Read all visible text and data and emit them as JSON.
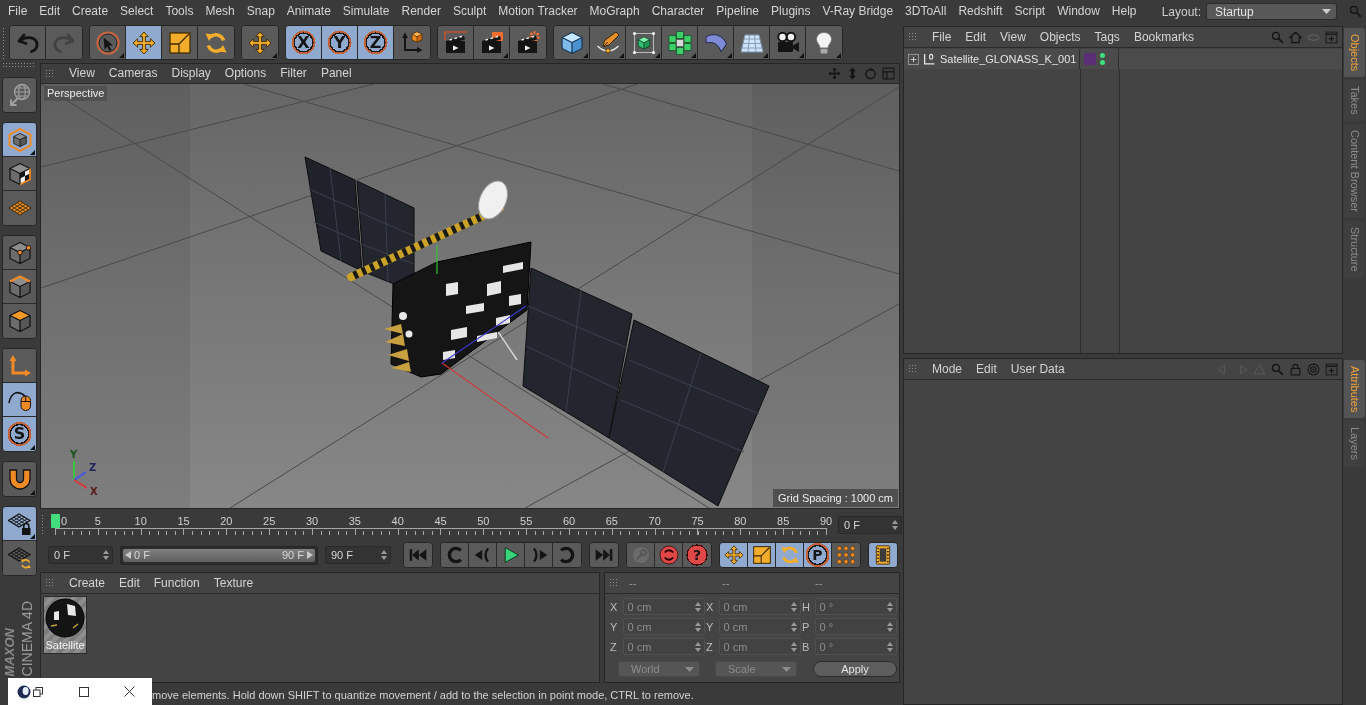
{
  "menu_bar": {
    "items": [
      "File",
      "Edit",
      "Create",
      "Select",
      "Tools",
      "Mesh",
      "Snap",
      "Animate",
      "Simulate",
      "Render",
      "Sculpt",
      "Motion Tracker",
      "MoGraph",
      "Character",
      "Pipeline",
      "Plugins",
      "V-Ray Bridge",
      "3DToAll",
      "Redshift",
      "Script",
      "Window",
      "Help"
    ],
    "layout_label": "Layout:",
    "layout_value": "Startup"
  },
  "toolbar": {
    "groups": [
      {
        "buttons": [
          {
            "kind": "undo",
            "active": false,
            "disabled": false,
            "submenu": false
          },
          {
            "kind": "redo",
            "active": false,
            "disabled": true,
            "submenu": false
          }
        ]
      },
      {
        "buttons": [
          {
            "kind": "live-select",
            "active": false,
            "disabled": false,
            "submenu": true
          },
          {
            "kind": "move",
            "active": true,
            "disabled": false,
            "submenu": false
          },
          {
            "kind": "scale",
            "active": false,
            "disabled": false,
            "submenu": false
          },
          {
            "kind": "rotate",
            "active": false,
            "disabled": false,
            "submenu": false
          }
        ]
      },
      {
        "buttons": [
          {
            "kind": "move",
            "active": false,
            "disabled": false,
            "submenu": true
          }
        ]
      },
      {
        "buttons": [
          {
            "kind": "axis-lock",
            "label": "X",
            "active": true,
            "disabled": false,
            "submenu": false
          },
          {
            "kind": "axis-lock",
            "label": "Y",
            "active": true,
            "disabled": false,
            "submenu": false
          },
          {
            "kind": "axis-lock",
            "label": "Z",
            "active": true,
            "disabled": false,
            "submenu": false
          },
          {
            "kind": "coordinate-system",
            "active": false,
            "disabled": false,
            "submenu": false
          }
        ]
      },
      {
        "buttons": [
          {
            "kind": "render-view",
            "active": false,
            "disabled": false,
            "submenu": false
          },
          {
            "kind": "render-picture-viewer",
            "active": false,
            "disabled": false,
            "submenu": true
          },
          {
            "kind": "render-settings",
            "active": false,
            "disabled": false,
            "submenu": false
          }
        ]
      },
      {
        "buttons": [
          {
            "kind": "cube",
            "active": false,
            "disabled": false,
            "submenu": true
          },
          {
            "kind": "pen",
            "active": false,
            "disabled": false,
            "submenu": true
          },
          {
            "kind": "subdivision",
            "active": false,
            "disabled": false,
            "submenu": true
          },
          {
            "kind": "cloner",
            "active": false,
            "disabled": false,
            "submenu": true
          },
          {
            "kind": "bend",
            "active": false,
            "disabled": false,
            "submenu": true
          },
          {
            "kind": "floor",
            "active": false,
            "disabled": false,
            "submenu": true
          },
          {
            "kind": "camera",
            "active": false,
            "disabled": false,
            "submenu": true
          },
          {
            "kind": "light",
            "active": false,
            "disabled": false,
            "submenu": true
          }
        ]
      }
    ]
  },
  "tool_palette": {
    "groups": [
      {
        "buttons": [
          {
            "kind": "make-editable",
            "active": false,
            "submenu": false
          }
        ]
      },
      {
        "buttons": [
          {
            "kind": "model",
            "active": true,
            "submenu": true
          },
          {
            "kind": "texture",
            "active": false,
            "submenu": false
          },
          {
            "kind": "workplane",
            "active": false,
            "submenu": false
          }
        ]
      },
      {
        "buttons": [
          {
            "kind": "points",
            "active": false,
            "submenu": false
          },
          {
            "kind": "edges",
            "active": false,
            "submenu": false
          },
          {
            "kind": "polygons",
            "active": false,
            "submenu": false
          }
        ]
      },
      {
        "buttons": [
          {
            "kind": "axis-mode",
            "active": false,
            "submenu": false
          },
          {
            "kind": "tweak",
            "active": true,
            "submenu": false
          },
          {
            "kind": "solo",
            "label": "S",
            "active": true,
            "submenu": true
          }
        ]
      },
      {
        "buttons": [
          {
            "kind": "snap",
            "active": false,
            "submenu": true
          }
        ]
      },
      {
        "buttons": [
          {
            "kind": "workplane-lock",
            "active": true,
            "submenu": true
          },
          {
            "kind": "workplane-align",
            "active": false,
            "submenu": false
          }
        ]
      }
    ]
  },
  "viewport": {
    "menu": [
      "View",
      "Cameras",
      "Display",
      "Options",
      "Filter",
      "Panel"
    ],
    "camera": "Perspective",
    "grid_spacing": "Grid Spacing : 1000 cm",
    "gizmo_axes": [
      {
        "label": "Y",
        "color": "#3cc43c"
      },
      {
        "label": "Z",
        "color": "#4b5bd6"
      },
      {
        "label": "X",
        "color": "#d23c3c"
      }
    ]
  },
  "timeline": {
    "labels": [
      "0",
      "5",
      "10",
      "15",
      "20",
      "25",
      "30",
      "35",
      "40",
      "45",
      "50",
      "55",
      "60",
      "65",
      "70",
      "75",
      "80",
      "85",
      "90"
    ],
    "playhead": {
      "level": 0
    },
    "current_frame": "0 F"
  },
  "transport": {
    "start_frame": "0 F",
    "range": {
      "start": "0 F",
      "end": "90 F",
      "level": 1
    },
    "end_frame": "90 F",
    "groups": [
      {
        "buttons": [
          {
            "kind": "go-start",
            "active": false,
            "disabled": false
          }
        ]
      },
      {
        "buttons": [
          {
            "kind": "prev-key",
            "active": false,
            "disabled": false
          },
          {
            "kind": "prev-frame",
            "active": false,
            "disabled": false
          },
          {
            "kind": "play",
            "active": false,
            "disabled": false
          },
          {
            "kind": "next-frame",
            "active": false,
            "disabled": false
          },
          {
            "kind": "next-key",
            "active": false,
            "disabled": false
          }
        ]
      },
      {
        "buttons": [
          {
            "kind": "go-end",
            "active": false,
            "disabled": false
          }
        ]
      },
      {
        "buttons": [
          {
            "kind": "record",
            "active": false,
            "disabled": true
          },
          {
            "kind": "autokey",
            "active": false,
            "disabled": false
          },
          {
            "kind": "help",
            "label": "?",
            "active": false,
            "disabled": false
          }
        ]
      },
      {
        "buttons": [
          {
            "kind": "key-move",
            "active": true,
            "disabled": false
          },
          {
            "kind": "key-scale",
            "active": true,
            "disabled": false
          },
          {
            "kind": "key-rotate",
            "active": true,
            "disabled": false
          },
          {
            "kind": "key-param",
            "label": "P",
            "active": true,
            "disabled": false
          },
          {
            "kind": "key-pla",
            "active": false,
            "disabled": false
          }
        ]
      },
      {
        "buttons": [
          {
            "kind": "timeline",
            "active": true,
            "disabled": false
          }
        ]
      }
    ]
  },
  "materials": {
    "menu": [
      "Create",
      "Edit",
      "Function",
      "Texture"
    ],
    "items": [
      {
        "name": "Satellite"
      }
    ]
  },
  "coordinates": {
    "headers": [
      "--",
      "--",
      "--"
    ],
    "rows": [
      [
        {
          "axis": "X",
          "value": "0 cm"
        },
        {
          "axis": "X",
          "value": "0 cm"
        },
        {
          "axis": "H",
          "value": "0 °"
        }
      ],
      [
        {
          "axis": "Y",
          "value": "0 cm"
        },
        {
          "axis": "Y",
          "value": "0 cm"
        },
        {
          "axis": "P",
          "value": "0 °"
        }
      ],
      [
        {
          "axis": "Z",
          "value": "0 cm"
        },
        {
          "axis": "Z",
          "value": "0 cm"
        },
        {
          "axis": "B",
          "value": "0 °"
        }
      ]
    ],
    "space": "World",
    "mode": "Scale",
    "apply": "Apply"
  },
  "status_bar": {
    "text": "move elements. Hold down SHIFT to quantize movement / add to the selection in point mode, CTRL to remove."
  },
  "logo": {
    "brand": "MAXON",
    "product": "CINEMA 4D"
  },
  "object_manager": {
    "menu": [
      "File",
      "Edit",
      "View",
      "Objects",
      "Tags",
      "Bookmarks"
    ],
    "objects": [
      {
        "name": "Satellite_GLONASS_K_001",
        "expanded": false,
        "color": "#5b2f78",
        "editor_visible": true,
        "render_visible": true
      }
    ]
  },
  "attribute_manager": {
    "menu": [
      "Mode",
      "Edit",
      "User Data"
    ]
  },
  "side_tabs": {
    "upper": [
      {
        "label": "Objects",
        "selected": true
      },
      {
        "label": "Takes",
        "selected": false
      },
      {
        "label": "Content Browser",
        "selected": false
      },
      {
        "label": "Structure",
        "selected": false
      }
    ],
    "lower": [
      {
        "label": "Attributes",
        "selected": true
      },
      {
        "label": "Layers",
        "selected": false
      }
    ]
  }
}
